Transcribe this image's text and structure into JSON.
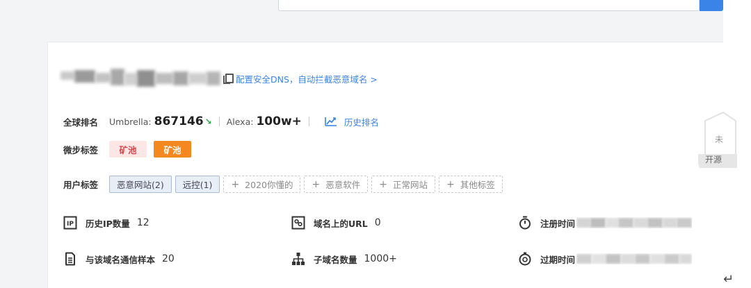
{
  "header": {
    "dns_link": "配置安全DNS，自动拦截恶意域名 >"
  },
  "rank": {
    "label": "全球排名",
    "umbrella_name": "Umbrella:",
    "umbrella_value": "867146",
    "umbrella_trend_icon": "down-right-arrow",
    "alexa_name": "Alexa:",
    "alexa_value": "100w+",
    "history_label": "历史排名",
    "history_icon": "trend-chart-icon"
  },
  "micro_tags": {
    "label": "微步标签",
    "tags": [
      {
        "text": "矿池",
        "style": "red"
      },
      {
        "text": "矿池",
        "style": "orange"
      }
    ]
  },
  "user_tags": {
    "label": "用户标签",
    "filled": [
      "恶意网站(2)",
      "远控(1)"
    ],
    "add": [
      "2020你懂的",
      "恶意软件",
      "正常网站",
      "其他标签"
    ]
  },
  "stats": {
    "history_ip": {
      "label": "历史IP数量",
      "value": "12",
      "icon": "ip-icon"
    },
    "url_count": {
      "label": "域名上的URL",
      "value": "0",
      "icon": "link-box-icon"
    },
    "register_time": {
      "label": "注册时间",
      "icon": "stopwatch-icon"
    },
    "samples": {
      "label": "与该域名通信样本",
      "value": "20",
      "icon": "document-icon"
    },
    "subdomains": {
      "label": "子域名数量",
      "value": "1000+",
      "icon": "hierarchy-icon"
    },
    "expire_time": {
      "label": "过期时间",
      "icon": "clock-circle-icon"
    }
  },
  "watermark": {
    "line1": "未",
    "line2": "开源"
  },
  "colors": {
    "accent": "#3a84e8",
    "tag_red_bg": "#fde6e6",
    "tag_red_fg": "#e04242",
    "tag_orange": "#f5871f",
    "trend_down": "#2aa146"
  }
}
